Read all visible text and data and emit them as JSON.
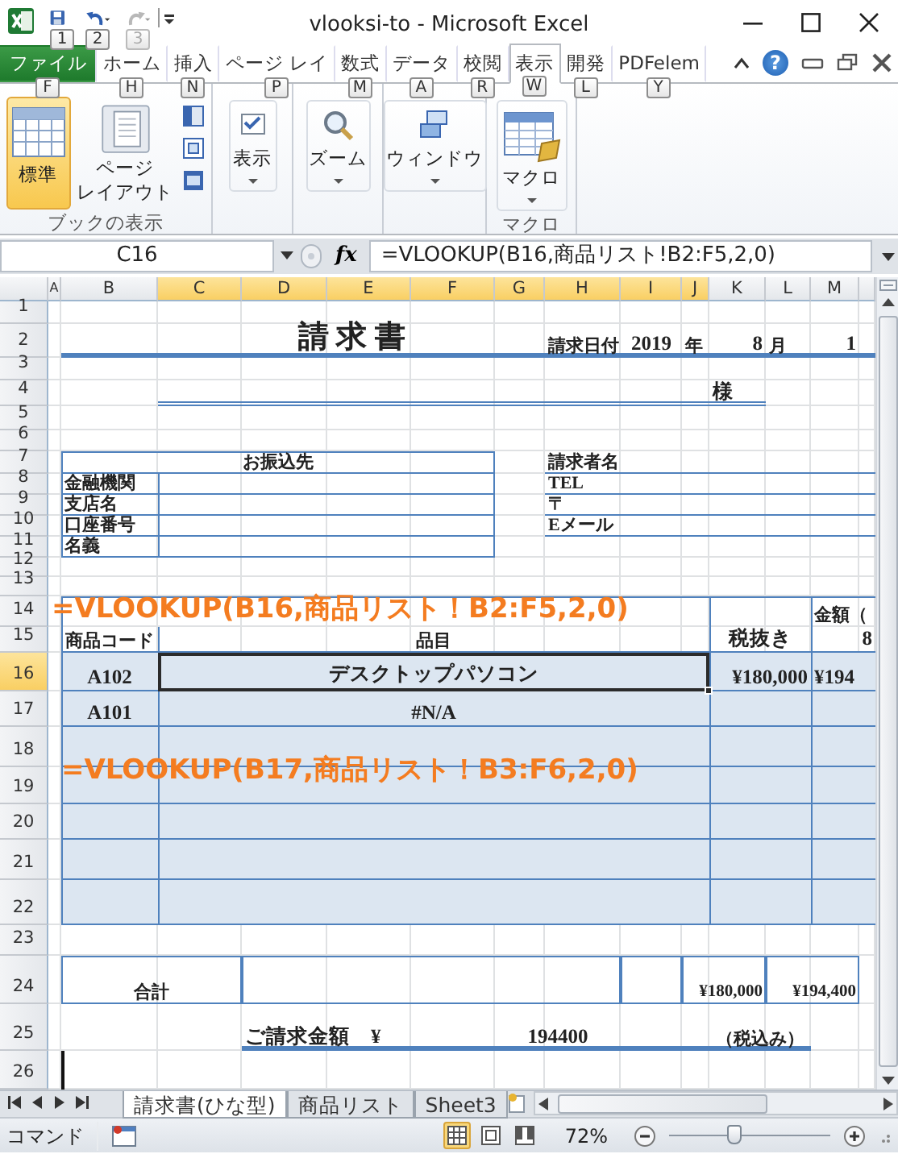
{
  "window": {
    "title": "vlooksi-to  -  Microsoft Excel"
  },
  "quick_access": [
    {
      "kind": "save",
      "keytip": "1",
      "disabled": false
    },
    {
      "kind": "undo",
      "keytip": "2",
      "disabled": false
    },
    {
      "kind": "redo",
      "keytip": "3",
      "disabled": true
    }
  ],
  "ribbon_tabs": [
    {
      "label": "ファイル",
      "keytip": "F",
      "kind": "file",
      "selected": false
    },
    {
      "label": "ホーム",
      "keytip": "H",
      "kind": "tab",
      "selected": false
    },
    {
      "label": "挿入",
      "keytip": "N",
      "kind": "tab",
      "selected": false
    },
    {
      "label": "ページ レイ",
      "keytip": "P",
      "kind": "tab",
      "selected": false
    },
    {
      "label": "数式",
      "keytip": "M",
      "kind": "tab",
      "selected": false
    },
    {
      "label": "データ",
      "keytip": "A",
      "kind": "tab",
      "selected": false
    },
    {
      "label": "校閲",
      "keytip": "R",
      "kind": "tab",
      "selected": false
    },
    {
      "label": "表示",
      "keytip": "W",
      "kind": "tab",
      "selected": true
    },
    {
      "label": "開発",
      "keytip": "L",
      "kind": "tab",
      "selected": false
    },
    {
      "label": "PDFelem",
      "keytip": "Y",
      "kind": "tab",
      "selected": false
    }
  ],
  "help": "?",
  "ribbon_groups": [
    {
      "label": "ブックの表示",
      "buttons": [
        {
          "kind": "normal-view",
          "label": "標準",
          "selected": true,
          "dropdown": false
        },
        {
          "kind": "page-layout",
          "label": "ページレイアウト",
          "selected": false,
          "dropdown": false
        },
        {
          "kind": "page-break",
          "selected": false
        },
        {
          "kind": "custom-views",
          "selected": false
        },
        {
          "kind": "full-screen",
          "selected": false
        }
      ]
    },
    {
      "buttons": [
        {
          "kind": "show",
          "label": "表示",
          "dropdown": true
        }
      ]
    },
    {
      "buttons": [
        {
          "kind": "zoom",
          "label": "ズーム",
          "dropdown": true
        }
      ]
    },
    {
      "buttons": [
        {
          "kind": "window",
          "label": "ウィンドウ",
          "dropdown": true
        }
      ]
    },
    {
      "label": "マクロ",
      "buttons": [
        {
          "kind": "macro",
          "label": "マクロ",
          "dropdown": true
        }
      ]
    }
  ],
  "formula_bar": {
    "name_box": "C16",
    "function_button": "fx",
    "formula": "=VLOOKUP(B16,商品リスト!B2:F5,2,0)"
  },
  "columns": [
    {
      "label": "A",
      "selected": false
    },
    {
      "label": "B",
      "selected": false
    },
    {
      "label": "C",
      "selected": true
    },
    {
      "label": "D",
      "selected": true
    },
    {
      "label": "E",
      "selected": true
    },
    {
      "label": "F",
      "selected": true
    },
    {
      "label": "G",
      "selected": true
    },
    {
      "label": "H",
      "selected": true
    },
    {
      "label": "I",
      "selected": true
    },
    {
      "label": "J",
      "selected": true
    },
    {
      "label": "K",
      "selected": false
    },
    {
      "label": "L",
      "selected": false
    },
    {
      "label": "M",
      "selected": false
    }
  ],
  "rows": [
    {
      "label": "1",
      "selected": false
    },
    {
      "label": "2",
      "selected": false
    },
    {
      "label": "3",
      "selected": false
    },
    {
      "label": "4",
      "selected": false
    },
    {
      "label": "5",
      "selected": false
    },
    {
      "label": "6",
      "selected": false
    },
    {
      "label": "7",
      "selected": false
    },
    {
      "label": "8",
      "selected": false
    },
    {
      "label": "9",
      "selected": false
    },
    {
      "label": "10",
      "selected": false
    },
    {
      "label": "11",
      "selected": false
    },
    {
      "label": "12",
      "selected": false
    },
    {
      "label": "13",
      "selected": false
    },
    {
      "label": "14",
      "selected": false
    },
    {
      "label": "15",
      "selected": false
    },
    {
      "label": "16",
      "selected": true
    },
    {
      "label": "17",
      "selected": false
    },
    {
      "label": "18",
      "selected": false
    },
    {
      "label": "19",
      "selected": false
    },
    {
      "label": "20",
      "selected": false
    },
    {
      "label": "21",
      "selected": false
    },
    {
      "label": "22",
      "selected": false
    },
    {
      "label": "23",
      "selected": false
    },
    {
      "label": "24",
      "selected": false
    },
    {
      "label": "25",
      "selected": false
    },
    {
      "label": "26",
      "selected": false
    }
  ],
  "cells": [
    {
      "text": "請 求 書",
      "selected": false
    },
    {
      "text": "請求日付",
      "selected": false
    },
    {
      "text": "2019",
      "selected": false
    },
    {
      "text": "年",
      "selected": false
    },
    {
      "text": "8",
      "selected": false
    },
    {
      "text": "月",
      "selected": false
    },
    {
      "text": "1",
      "selected": false
    },
    {
      "text": "様",
      "selected": false
    },
    {
      "text": "お振込先",
      "selected": false
    },
    {
      "text": "請求者名",
      "selected": false
    },
    {
      "text": "金融機関",
      "selected": false
    },
    {
      "text": "TEL",
      "selected": false
    },
    {
      "text": "支店名",
      "selected": false
    },
    {
      "text": "〒",
      "selected": false
    },
    {
      "text": "口座番号",
      "selected": false
    },
    {
      "text": "Eメール",
      "selected": false
    },
    {
      "text": "名義",
      "selected": false
    },
    {
      "text": "金額（",
      "selected": false
    },
    {
      "text": "商品コード",
      "selected": false
    },
    {
      "text": "品目",
      "selected": false
    },
    {
      "text": "税抜き",
      "selected": false
    },
    {
      "text": "8",
      "selected": false
    },
    {
      "text": "A102",
      "selected": false
    },
    {
      "text": "デスクトップパソコン",
      "selected": true
    },
    {
      "text": "¥180,000",
      "selected": false
    },
    {
      "text": "¥194",
      "selected": false
    },
    {
      "text": "A101",
      "selected": false
    },
    {
      "text": "#N/A",
      "selected": false
    },
    {
      "text": "合計",
      "selected": false
    },
    {
      "text": "¥180,000",
      "selected": false
    },
    {
      "text": "¥194,400",
      "selected": false
    },
    {
      "text": "ご請求金額　¥",
      "selected": false
    },
    {
      "text": "194400",
      "selected": false
    },
    {
      "text": "（税込み）",
      "selected": false
    }
  ],
  "annotations": [
    "=VLOOKUP(B16,商品リスト！B2:F5,2,0)",
    "=VLOOKUP(B17,商品リスト！B3:F6,2,0)"
  ],
  "sheet_tabs": [
    {
      "label": "請求書(ひな型)",
      "selected": true
    },
    {
      "label": "商品リスト",
      "selected": false
    },
    {
      "label": "Sheet3",
      "selected": false
    }
  ],
  "status_bar": {
    "mode": "コマンド",
    "views": [
      {
        "kind": "normal",
        "selected": true
      },
      {
        "kind": "page-layout",
        "selected": false
      },
      {
        "kind": "page-break",
        "selected": false
      }
    ],
    "zoom": "72%",
    "zoom_slider": {
      "level": 0.4
    }
  }
}
